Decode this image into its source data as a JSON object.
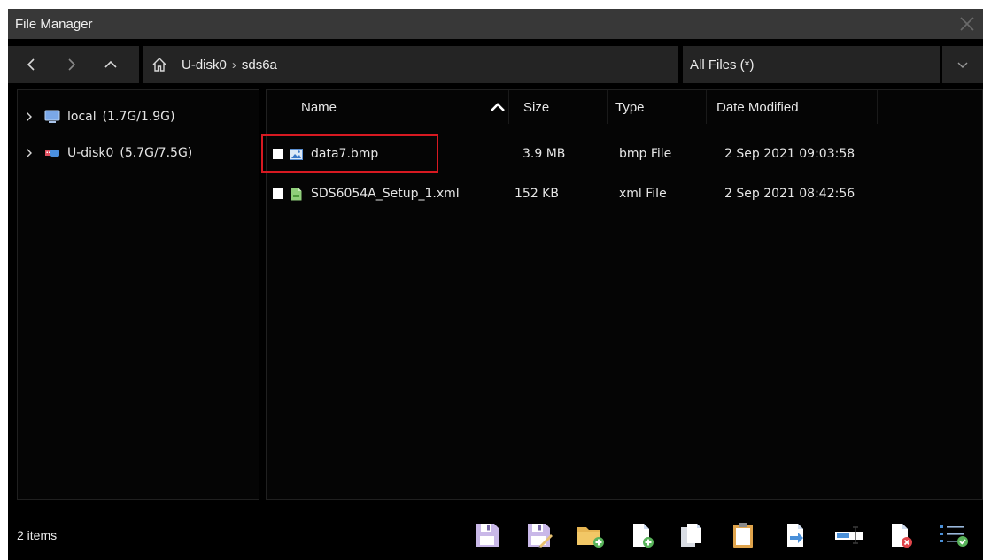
{
  "window": {
    "title": "File Manager"
  },
  "nav": {
    "path": [
      "U-disk0",
      "sds6a"
    ],
    "path_separator": "›",
    "filter": "All Files (*)"
  },
  "sidebar": {
    "items": [
      {
        "name": "local",
        "capacity": "(1.7G/1.9G)",
        "icon": "monitor-icon"
      },
      {
        "name": "U-disk0",
        "capacity": "(5.7G/7.5G)",
        "icon": "usb-icon"
      }
    ]
  },
  "table": {
    "columns": [
      "Name",
      "Size",
      "Type",
      "Date Modified"
    ],
    "sort": {
      "column": "Name",
      "direction": "ascending"
    },
    "rows": [
      {
        "name": "data7.bmp",
        "size": "3.9 MB",
        "type": "bmp File",
        "modified": "2 Sep 2021 09:03:58",
        "icon": "image-file-icon",
        "selected": false
      },
      {
        "name": "SDS6054A_Setup_1.xml",
        "size": "152 KB",
        "type": "xml File",
        "modified": "2 Sep 2021 08:42:56",
        "icon": "xml-file-icon",
        "selected": false
      }
    ]
  },
  "status": {
    "count": "2  items"
  },
  "colors": {
    "highlight": "#d71921",
    "toolbar_accent": "#4a90d9"
  }
}
